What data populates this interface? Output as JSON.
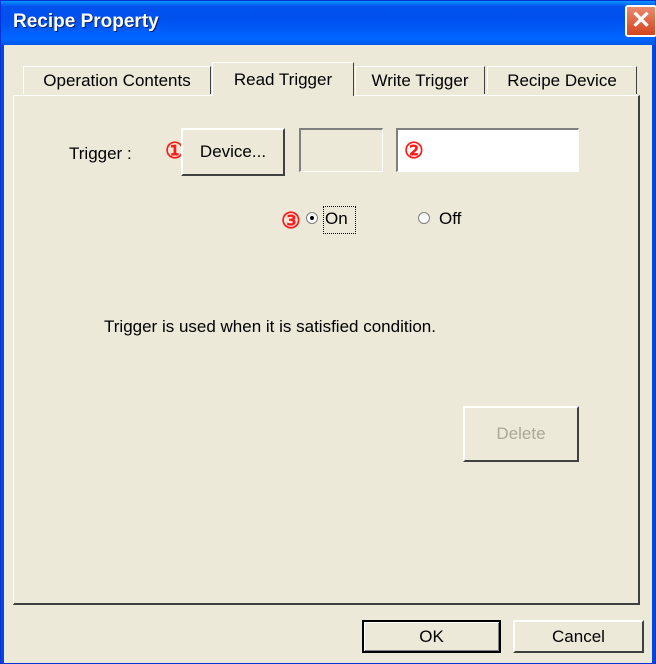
{
  "window": {
    "title": "Recipe Property"
  },
  "tabs": [
    {
      "label": "Operation Contents"
    },
    {
      "label": "Read Trigger"
    },
    {
      "label": "Write Trigger"
    },
    {
      "label": "Recipe Device"
    }
  ],
  "trigger": {
    "label": "Trigger :",
    "marker1": "①",
    "device_button": "Device...",
    "marker2": "②",
    "device_value": "",
    "marker3": "③",
    "on_label": "On",
    "off_label": "Off",
    "selected": "On",
    "description": "Trigger is used when it is satisfied condition.",
    "delete_button": "Delete"
  },
  "footer": {
    "ok_label": "OK",
    "cancel_label": "Cancel"
  },
  "colors": {
    "titlebar": "#0054e3",
    "marker": "#ff1a1a",
    "face": "#ece9d8",
    "close": "#d5431f"
  }
}
